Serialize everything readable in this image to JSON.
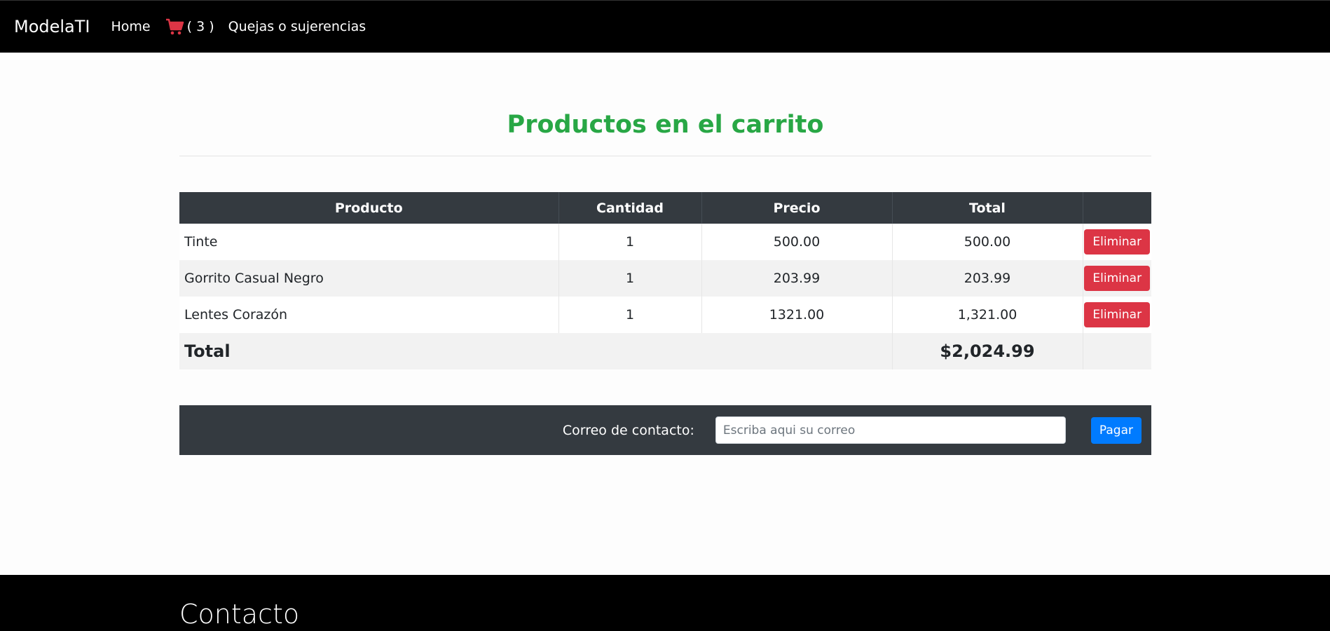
{
  "nav": {
    "brand": "ModelaTI",
    "home": "Home",
    "cart_icon": "shopping-cart-icon",
    "cart_count": "( 3 )",
    "complaints": "Quejas o sujerencias"
  },
  "page": {
    "title": "Productos en el carrito"
  },
  "table": {
    "headers": [
      "Producto",
      "Cantidad",
      "Precio",
      "Total",
      ""
    ],
    "rows": [
      {
        "product": "Tinte",
        "qty": "1",
        "price": "500.00",
        "total": "500.00",
        "action": "Eliminar"
      },
      {
        "product": "Gorrito Casual Negro",
        "qty": "1",
        "price": "203.99",
        "total": "203.99",
        "action": "Eliminar"
      },
      {
        "product": "Lentes Corazón",
        "qty": "1",
        "price": "1321.00",
        "total": "1,321.00",
        "action": "Eliminar"
      }
    ],
    "total_label": "Total",
    "grand_total": "$2,024.99"
  },
  "checkout": {
    "email_label": "Correo de contacto:",
    "email_placeholder": "Escriba aqui su correo",
    "email_value": "",
    "pay_label": "Pagar"
  },
  "footer": {
    "title": "Contacto"
  },
  "colors": {
    "title_green": "#28a745",
    "table_header": "#343a40",
    "delete_red": "#dc3545",
    "pay_blue": "#007bff"
  }
}
